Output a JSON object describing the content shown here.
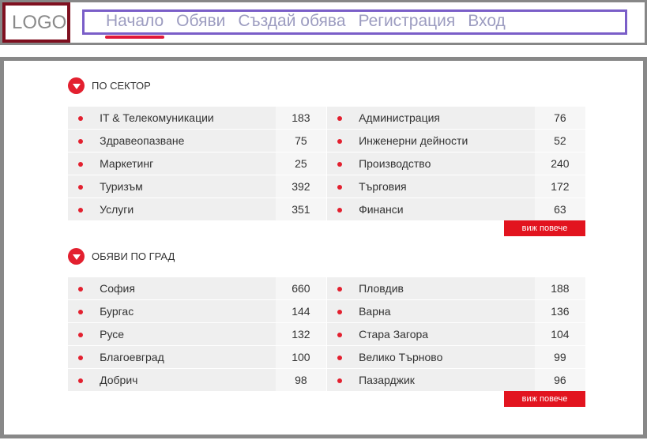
{
  "header": {
    "logo": "LOGO",
    "nav": [
      "Начало",
      "Обяви",
      "Създай обява",
      "Регистрация",
      "Вход"
    ]
  },
  "sections": [
    {
      "title": "ПО СЕКТОР",
      "rows": [
        {
          "left": {
            "name": "IT & Телекомуникации",
            "count": "183"
          },
          "right": {
            "name": "Администрация",
            "count": "76"
          }
        },
        {
          "left": {
            "name": "Здравеопазване",
            "count": "75"
          },
          "right": {
            "name": "Инженерни дейности",
            "count": "52"
          }
        },
        {
          "left": {
            "name": "Маркетинг",
            "count": "25"
          },
          "right": {
            "name": "Производство",
            "count": "240"
          }
        },
        {
          "left": {
            "name": "Туризъм",
            "count": "392"
          },
          "right": {
            "name": "Търговия",
            "count": "172"
          }
        },
        {
          "left": {
            "name": "Услуги",
            "count": "351"
          },
          "right": {
            "name": "Финанси",
            "count": "63"
          }
        }
      ],
      "more": "виж повече"
    },
    {
      "title": "ОБЯВИ ПО ГРАД",
      "rows": [
        {
          "left": {
            "name": "София",
            "count": "660"
          },
          "right": {
            "name": "Пловдив",
            "count": "188"
          }
        },
        {
          "left": {
            "name": "Бургас",
            "count": "144"
          },
          "right": {
            "name": "Варна",
            "count": "136"
          }
        },
        {
          "left": {
            "name": "Русе",
            "count": "132"
          },
          "right": {
            "name": "Стара Загора",
            "count": "104"
          }
        },
        {
          "left": {
            "name": "Благоевград",
            "count": "100"
          },
          "right": {
            "name": "Велико Търново",
            "count": "99"
          }
        },
        {
          "left": {
            "name": "Добрич",
            "count": "98"
          },
          "right": {
            "name": "Пазарджик",
            "count": "96"
          }
        }
      ],
      "more": "виж повече"
    }
  ],
  "colors": {
    "accent": "#e3202f",
    "logo_border": "#7f1020",
    "nav_border": "#7a5ec8",
    "nav_text": "#9c9cc0"
  }
}
